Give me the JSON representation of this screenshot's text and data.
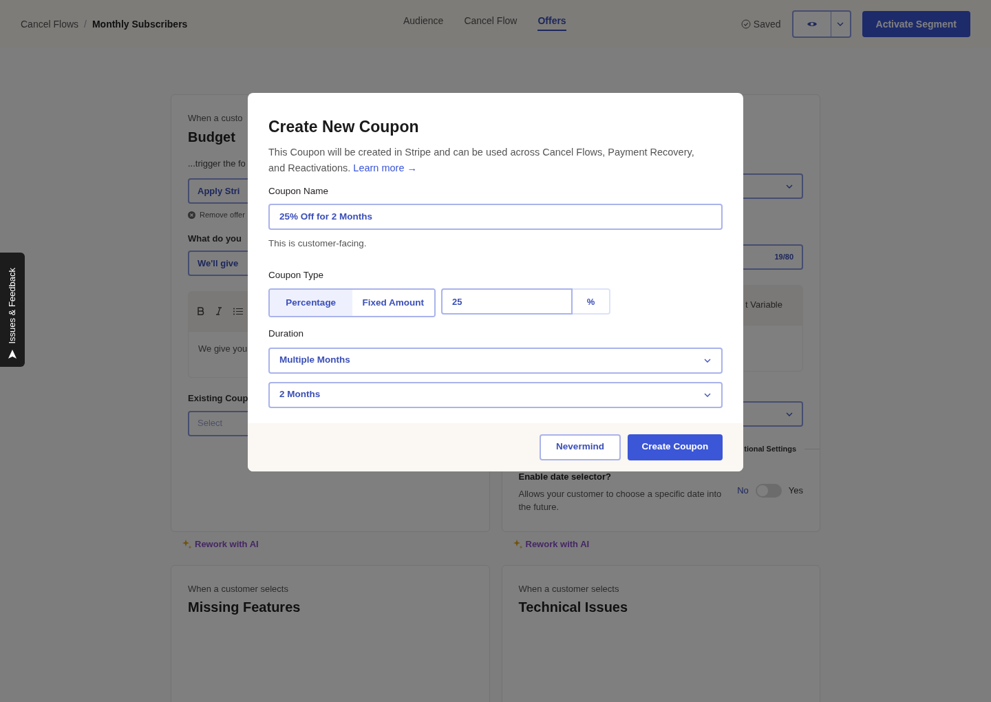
{
  "header": {
    "breadcrumb": [
      {
        "label": "Cancel Flows"
      },
      {
        "label": "Monthly Subscribers"
      }
    ],
    "separator": "/",
    "tabs": [
      {
        "label": "Audience",
        "selected": false
      },
      {
        "label": "Cancel Flow",
        "selected": false
      },
      {
        "label": "Offers",
        "selected": true
      }
    ],
    "saved": "Saved",
    "primary_button": "Activate Segment"
  },
  "feedback_tab": "Issues & Feedback",
  "left_card": {
    "intro": "When a custo",
    "title": "Budget",
    "trigger": "...trigger the fo",
    "offer_field": "Apply Stri",
    "remove": "Remove offer",
    "question": "What do you",
    "message_field": "We'll give",
    "editor_text": "We give you",
    "existing_label": "Existing Coup",
    "existing_placeholder": "Select",
    "rework": "Rework with AI"
  },
  "right_card": {
    "counter": "19/80",
    "toolbar_text": "t Variable",
    "section_label": "tional Settings",
    "date_title": "Enable date selector?",
    "date_desc": "Allows your customer to choose a specific date into the future.",
    "toggle": {
      "off_label": "No",
      "on_label": "Yes",
      "on": false
    },
    "rework": "Rework with AI"
  },
  "lower_cards": [
    {
      "intro": "When a customer selects",
      "title": "Missing Features"
    },
    {
      "intro": "When a customer selects",
      "title": "Technical Issues"
    }
  ],
  "modal": {
    "title": "Create New Coupon",
    "description": "This Coupon will be created in Stripe and can be used across Cancel Flows, Payment Recovery, and Reactivations.",
    "link": "Learn more →",
    "name_label": "Coupon Name",
    "name_value": "25% Off for 2 Months",
    "name_hint": "This is customer-facing.",
    "type_label": "Coupon Type",
    "type_options": [
      {
        "label": "Percentage",
        "selected": true
      },
      {
        "label": "Fixed Amount",
        "selected": false
      }
    ],
    "amount": "25",
    "unit": "%",
    "duration_label": "Duration",
    "duration": "Multiple Months",
    "months": "2 Months",
    "cancel": "Nevermind",
    "submit": "Create Coupon"
  }
}
